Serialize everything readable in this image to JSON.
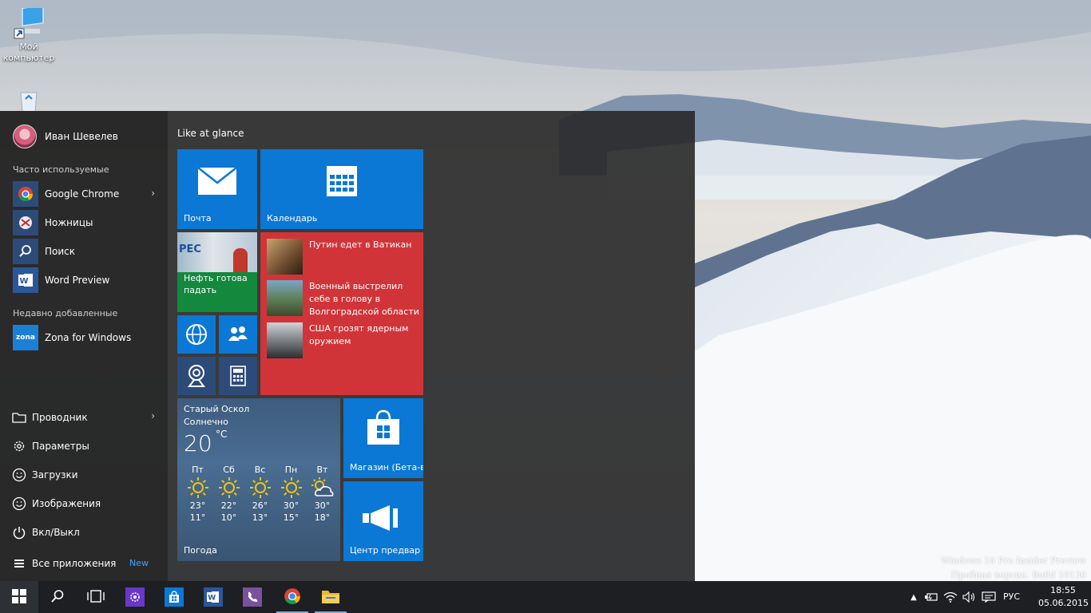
{
  "desktop": {
    "icons": [
      {
        "label": "Мой компьютер",
        "icon": "computer-icon"
      },
      {
        "label": "",
        "icon": "recycle-bin-icon"
      }
    ],
    "watermark": {
      "line1": "Windows 10 Pro Insider Preview",
      "line2": "Пробная версия. Build 10130"
    }
  },
  "start_menu": {
    "user": {
      "name": "Иван Шевелев"
    },
    "most_used_label": "Часто используемые",
    "most_used": [
      {
        "label": "Google Chrome",
        "icon": "chrome-icon",
        "has_submenu": true
      },
      {
        "label": "Ножницы",
        "icon": "scissors-icon"
      },
      {
        "label": "Поиск",
        "icon": "search-icon"
      },
      {
        "label": "Word Preview",
        "icon": "word-icon"
      }
    ],
    "recent_label": "Недавно добавленные",
    "recent": [
      {
        "label": "Zona for Windows",
        "icon": "zona-icon",
        "badge": "zona"
      }
    ],
    "system": [
      {
        "label": "Проводник",
        "icon": "folder-icon",
        "has_submenu": true
      },
      {
        "label": "Параметры",
        "icon": "gear-icon"
      },
      {
        "label": "Загрузки",
        "icon": "smiley-icon"
      },
      {
        "label": "Изображения",
        "icon": "smiley-icon"
      },
      {
        "label": "Вкл/Выкл",
        "icon": "power-icon"
      }
    ],
    "all_apps": {
      "label": "Все приложения",
      "badge": "New"
    },
    "group_title": "Like at glance",
    "tiles": {
      "mail": {
        "label": "Почта",
        "color": "#0a78d4"
      },
      "calendar": {
        "label": "Календарь",
        "color": "#0a78d4"
      },
      "money": {
        "label": "Нефть готова падать",
        "color": "#13893d",
        "image_text": "PEC"
      },
      "news": {
        "color": "#d13438",
        "items": [
          {
            "text": "Путин едет в Ватикан"
          },
          {
            "text": "Военный выстрелил себе в голову в Волгоградской области"
          },
          {
            "text": "США грозят ядерным оружием"
          }
        ]
      },
      "weather": {
        "city": "Старый Оскол",
        "condition": "Солнечно",
        "temp": "20",
        "unit": "°C",
        "label": "Погода",
        "days": [
          {
            "day": "Пт",
            "high": "23°",
            "low": "11°",
            "icon": "sun-icon"
          },
          {
            "day": "Сб",
            "high": "22°",
            "low": "10°",
            "icon": "sun-icon"
          },
          {
            "day": "Вс",
            "high": "26°",
            "low": "13°",
            "icon": "sun-icon"
          },
          {
            "day": "Пн",
            "high": "30°",
            "low": "15°",
            "icon": "sun-icon"
          },
          {
            "day": "Вт",
            "high": "30°",
            "low": "18°",
            "icon": "partly-cloudy-icon"
          }
        ]
      },
      "store": {
        "label": "Магазин (Бета-в",
        "color": "#0a78d4"
      },
      "feedback": {
        "label": "Центр предвар",
        "color": "#0a78d4"
      }
    }
  },
  "taskbar": {
    "apps": [
      {
        "icon": "windows-start-icon"
      },
      {
        "icon": "search-icon"
      },
      {
        "icon": "task-view-icon"
      },
      {
        "icon": "settings-app-icon",
        "color": "#6a37c8"
      },
      {
        "icon": "store-app-icon",
        "color": "#0a78d4"
      },
      {
        "icon": "word-app-icon",
        "color": "#2b579a"
      },
      {
        "icon": "viber-icon",
        "color": "#7b519d"
      },
      {
        "icon": "chrome-icon"
      },
      {
        "icon": "file-explorer-icon"
      }
    ],
    "tray": {
      "language": "РУС",
      "time": "18:55",
      "date": "05.06.2015"
    }
  }
}
